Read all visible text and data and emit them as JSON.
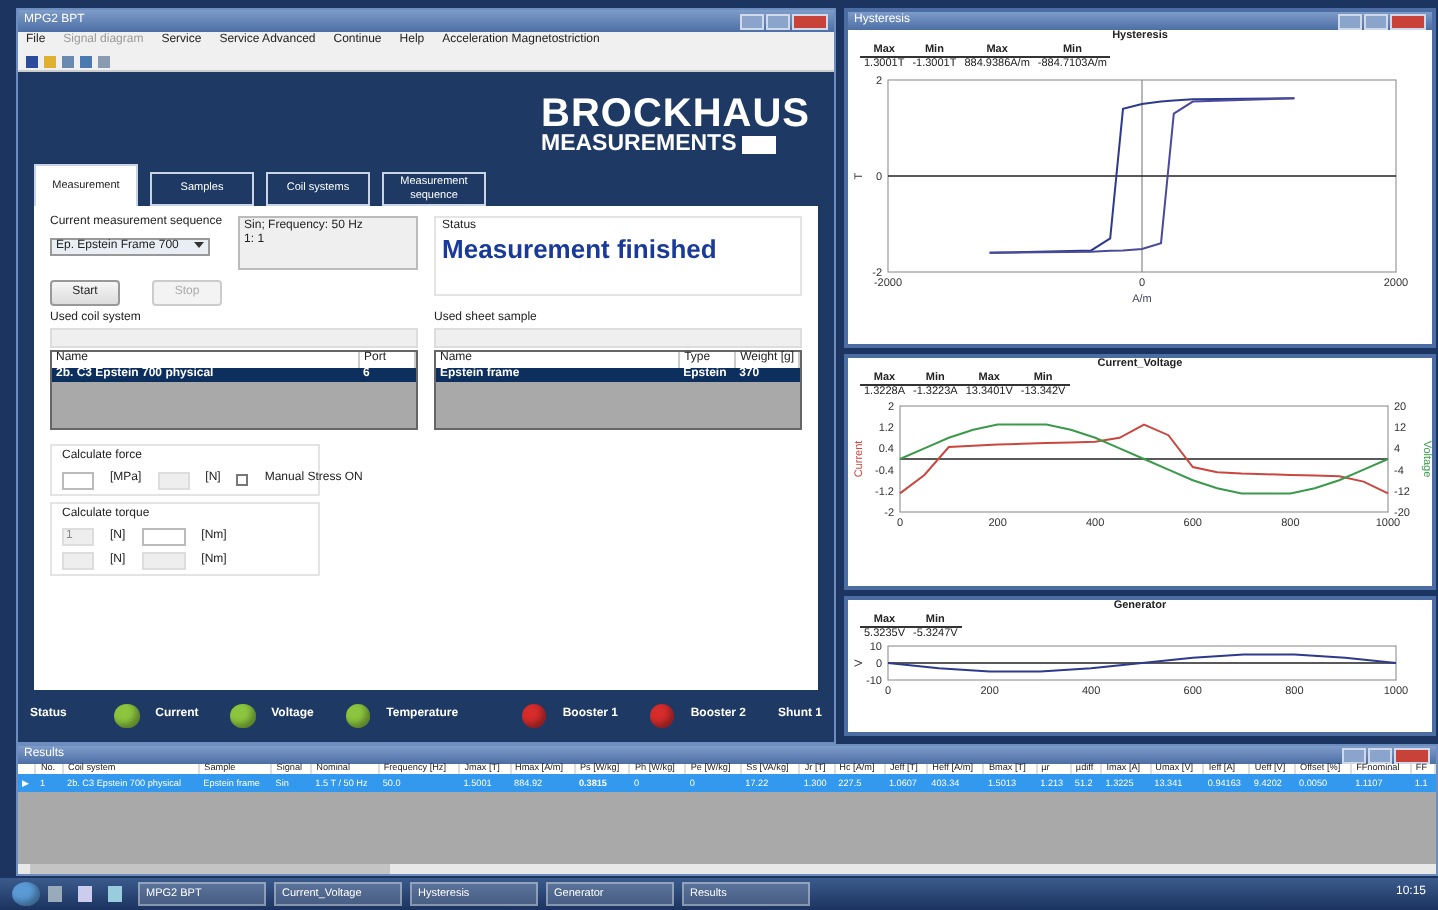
{
  "main_window": {
    "title": "MPG2 BPT",
    "menu": [
      {
        "label": "File",
        "disabled": false
      },
      {
        "label": "Signal diagram",
        "disabled": true
      },
      {
        "label": "Service",
        "disabled": false
      },
      {
        "label": "Service Advanced",
        "disabled": false
      },
      {
        "label": "Continue",
        "disabled": false
      },
      {
        "label": "Help",
        "disabled": false
      },
      {
        "label": "Acceleration Magnetostriction",
        "disabled": false
      }
    ],
    "logo": {
      "line_1": "BROCKHAUS",
      "line_2": "MEASUREMENTS"
    },
    "tabs": [
      {
        "label": "Measurement",
        "selected": true
      },
      {
        "label": "Samples",
        "selected": false
      },
      {
        "label": "Coil systems",
        "selected": false
      },
      {
        "label": "Measurement sequence",
        "selected": false
      }
    ],
    "sequence": {
      "label": "Current measurement sequence",
      "value": "Ep. Epstein Frame 700",
      "details": [
        "Sin; Frequency: 50 Hz",
        "1: 1"
      ]
    },
    "buttons": [
      {
        "label": "Start",
        "disabled": false
      },
      {
        "label": "Stop",
        "disabled": true
      }
    ],
    "status": {
      "label": "Status",
      "message": "Measurement finished"
    },
    "coil_system": {
      "title": "Used coil system",
      "columns": [
        "Name",
        "Port"
      ],
      "rows": [
        {
          "cells": [
            "2b. C3 Epstein 700 physical",
            "6"
          ],
          "selected": true
        }
      ]
    },
    "sheet_sample": {
      "title": "Used sheet sample",
      "columns": [
        "Name",
        "Type",
        "Weight [g]"
      ],
      "rows": [
        {
          "cells": [
            "Epstein frame",
            "Epstein",
            "370"
          ],
          "selected": true
        }
      ]
    },
    "force": {
      "title": "Calculate force",
      "fields": [
        {
          "unit": "[MPa]",
          "disabled": false
        },
        {
          "unit": "[N]",
          "disabled": true
        }
      ],
      "checkbox": {
        "label": "Manual Stress ON",
        "checked": false
      }
    },
    "torque": {
      "title": "Calculate torque",
      "rows": [
        [
          {
            "value": "1",
            "unit": "[N]",
            "disabled": true
          },
          {
            "unit": "[Nm]",
            "disabled": false
          }
        ],
        [
          {
            "unit": "[N]",
            "disabled": true
          },
          {
            "unit": "[Nm]",
            "disabled": true
          }
        ]
      ]
    },
    "status_bar": {
      "label": "Status",
      "indicators": [
        {
          "label": "Current",
          "color": "#8cc63f"
        },
        {
          "label": "Voltage",
          "color": "#8cc63f"
        },
        {
          "label": "Temperature",
          "color": "#8cc63f"
        },
        {
          "label": "Booster 1",
          "color": "#d62c2c"
        },
        {
          "label": "Booster 2",
          "color": "#d62c2c"
        }
      ],
      "extra": "Shunt 1"
    }
  },
  "hysteresis_window": {
    "title": "Hysteresis",
    "stats": {
      "headers": [
        "Max",
        "Min",
        "Max",
        "Min"
      ],
      "values": [
        "1.3001T",
        "-1.3001T",
        "884.9386A/m",
        "-884.7103A/m"
      ]
    },
    "chart_data": {
      "type": "line",
      "title": "Hysteresis",
      "xlabel": "A/m",
      "ylabel": "T",
      "x": [
        -1200,
        -400,
        -250,
        -150,
        0,
        150,
        250,
        400,
        1200
      ],
      "series": [
        {
          "color": "#2e3a8c",
          "values": [
            -1.6,
            -1.55,
            -1.3,
            1.4,
            1.5,
            1.55,
            1.57,
            1.6,
            1.62
          ]
        },
        {
          "color": "#4a4a9a",
          "values": [
            -1.6,
            -1.58,
            -1.56,
            -1.55,
            -1.52,
            -1.4,
            1.3,
            1.55,
            1.62
          ]
        }
      ],
      "xlim": [
        -2000,
        2000
      ],
      "ylim": [
        -2,
        2
      ],
      "xticks": [
        -2000,
        0,
        2000
      ],
      "yticks": [
        -2,
        0,
        2
      ]
    }
  },
  "current_voltage_window": {
    "stats": {
      "headers": [
        "Max",
        "Min",
        "Max",
        "Min"
      ],
      "values": [
        "1.3228A",
        "-1.3223A",
        "13.3401V",
        "-13.342V"
      ]
    },
    "chart_data": {
      "type": "line",
      "title": "Current_Voltage",
      "x": [
        0,
        50,
        100,
        150,
        200,
        250,
        300,
        350,
        400,
        450,
        500,
        550,
        600,
        650,
        700,
        750,
        800,
        850,
        900,
        950,
        1000
      ],
      "series": [
        {
          "name": "Current",
          "color": "#c9473f",
          "values": [
            -1.3,
            -0.6,
            0.45,
            0.5,
            0.55,
            0.57,
            0.6,
            0.62,
            0.65,
            0.8,
            1.3,
            0.9,
            -0.3,
            -0.5,
            -0.55,
            -0.57,
            -0.6,
            -0.62,
            -0.65,
            -0.85,
            -1.3
          ]
        },
        {
          "name": "Voltage",
          "color": "#3a9a4a",
          "axis": "y2",
          "values": [
            0,
            4,
            8,
            11,
            13,
            13,
            13,
            11,
            8,
            4,
            0,
            -4,
            -8,
            -11,
            -13,
            -13,
            -13,
            -11,
            -8,
            -4,
            0
          ]
        }
      ],
      "xlim": [
        0,
        1000
      ],
      "ylim": [
        -2,
        2
      ],
      "y2lim": [
        -20,
        20
      ],
      "xticks": [
        0,
        200,
        400,
        600,
        800,
        1000
      ],
      "yticks": [
        -2,
        -1.2,
        -0.4,
        0.4,
        1.2,
        2
      ],
      "y2ticks": [
        -20,
        -12,
        -4,
        4,
        12,
        20
      ]
    }
  },
  "generator_window": {
    "stats": {
      "headers": [
        "Max",
        "Min"
      ],
      "values": [
        "5.3235V",
        "-5.3247V"
      ]
    },
    "chart_data": {
      "type": "line",
      "title": "Generator",
      "ylabel": "V",
      "x": [
        0,
        100,
        200,
        300,
        400,
        500,
        600,
        700,
        800,
        900,
        1000
      ],
      "series": [
        {
          "color": "#2e3a8c",
          "values": [
            0,
            -3,
            -5,
            -5,
            -3,
            0,
            3,
            5,
            5,
            3,
            0
          ]
        }
      ],
      "xlim": [
        0,
        1000
      ],
      "ylim": [
        -10,
        10
      ],
      "xticks": [
        0,
        200,
        400,
        600,
        800,
        1000
      ],
      "yticks": [
        -10,
        0,
        10
      ]
    }
  },
  "results_window": {
    "title": "Results",
    "columns": [
      "No.",
      "Coil system",
      "Sample",
      "Signal",
      "Nominal",
      "Frequency [Hz]",
      "Jmax [T]",
      "Hmax [A/m]",
      "Ps [W/kg]",
      "Ph [W/kg]",
      "Pe [W/kg]",
      "Ss [VA/kg]",
      "Jr [T]",
      "Hc [A/m]",
      "Jeff [T]",
      "Heff [A/m]",
      "Bmax [T]",
      "µr",
      "µdiff",
      "Imax [A]",
      "Umax [V]",
      "Ieff [A]",
      "Ueff [V]",
      "Offset [%]",
      "FFnominal",
      "FF"
    ],
    "rows": [
      {
        "marker": "▶",
        "selected": true,
        "cells": [
          "1",
          "2b. C3 Epstein 700 physical",
          "Epstein frame",
          "Sin",
          "1.5 T / 50 Hz",
          "50.0",
          "1.5001",
          "884.92",
          "**0.3815**",
          "0",
          "0",
          "17.22",
          "1.300",
          "227.5",
          "1.0607",
          "403.34",
          "1.5013",
          "1.213",
          "51.2",
          "1.3225",
          "13.341",
          "0.94163",
          "9.4202",
          "0.0050",
          "1.1107",
          "1.1"
        ]
      }
    ]
  },
  "taskbar": {
    "buttons": [
      "MPG2 BPT",
      "Current_Voltage",
      "Hysteresis",
      "Generator",
      "Results"
    ],
    "clock": "10:15"
  }
}
